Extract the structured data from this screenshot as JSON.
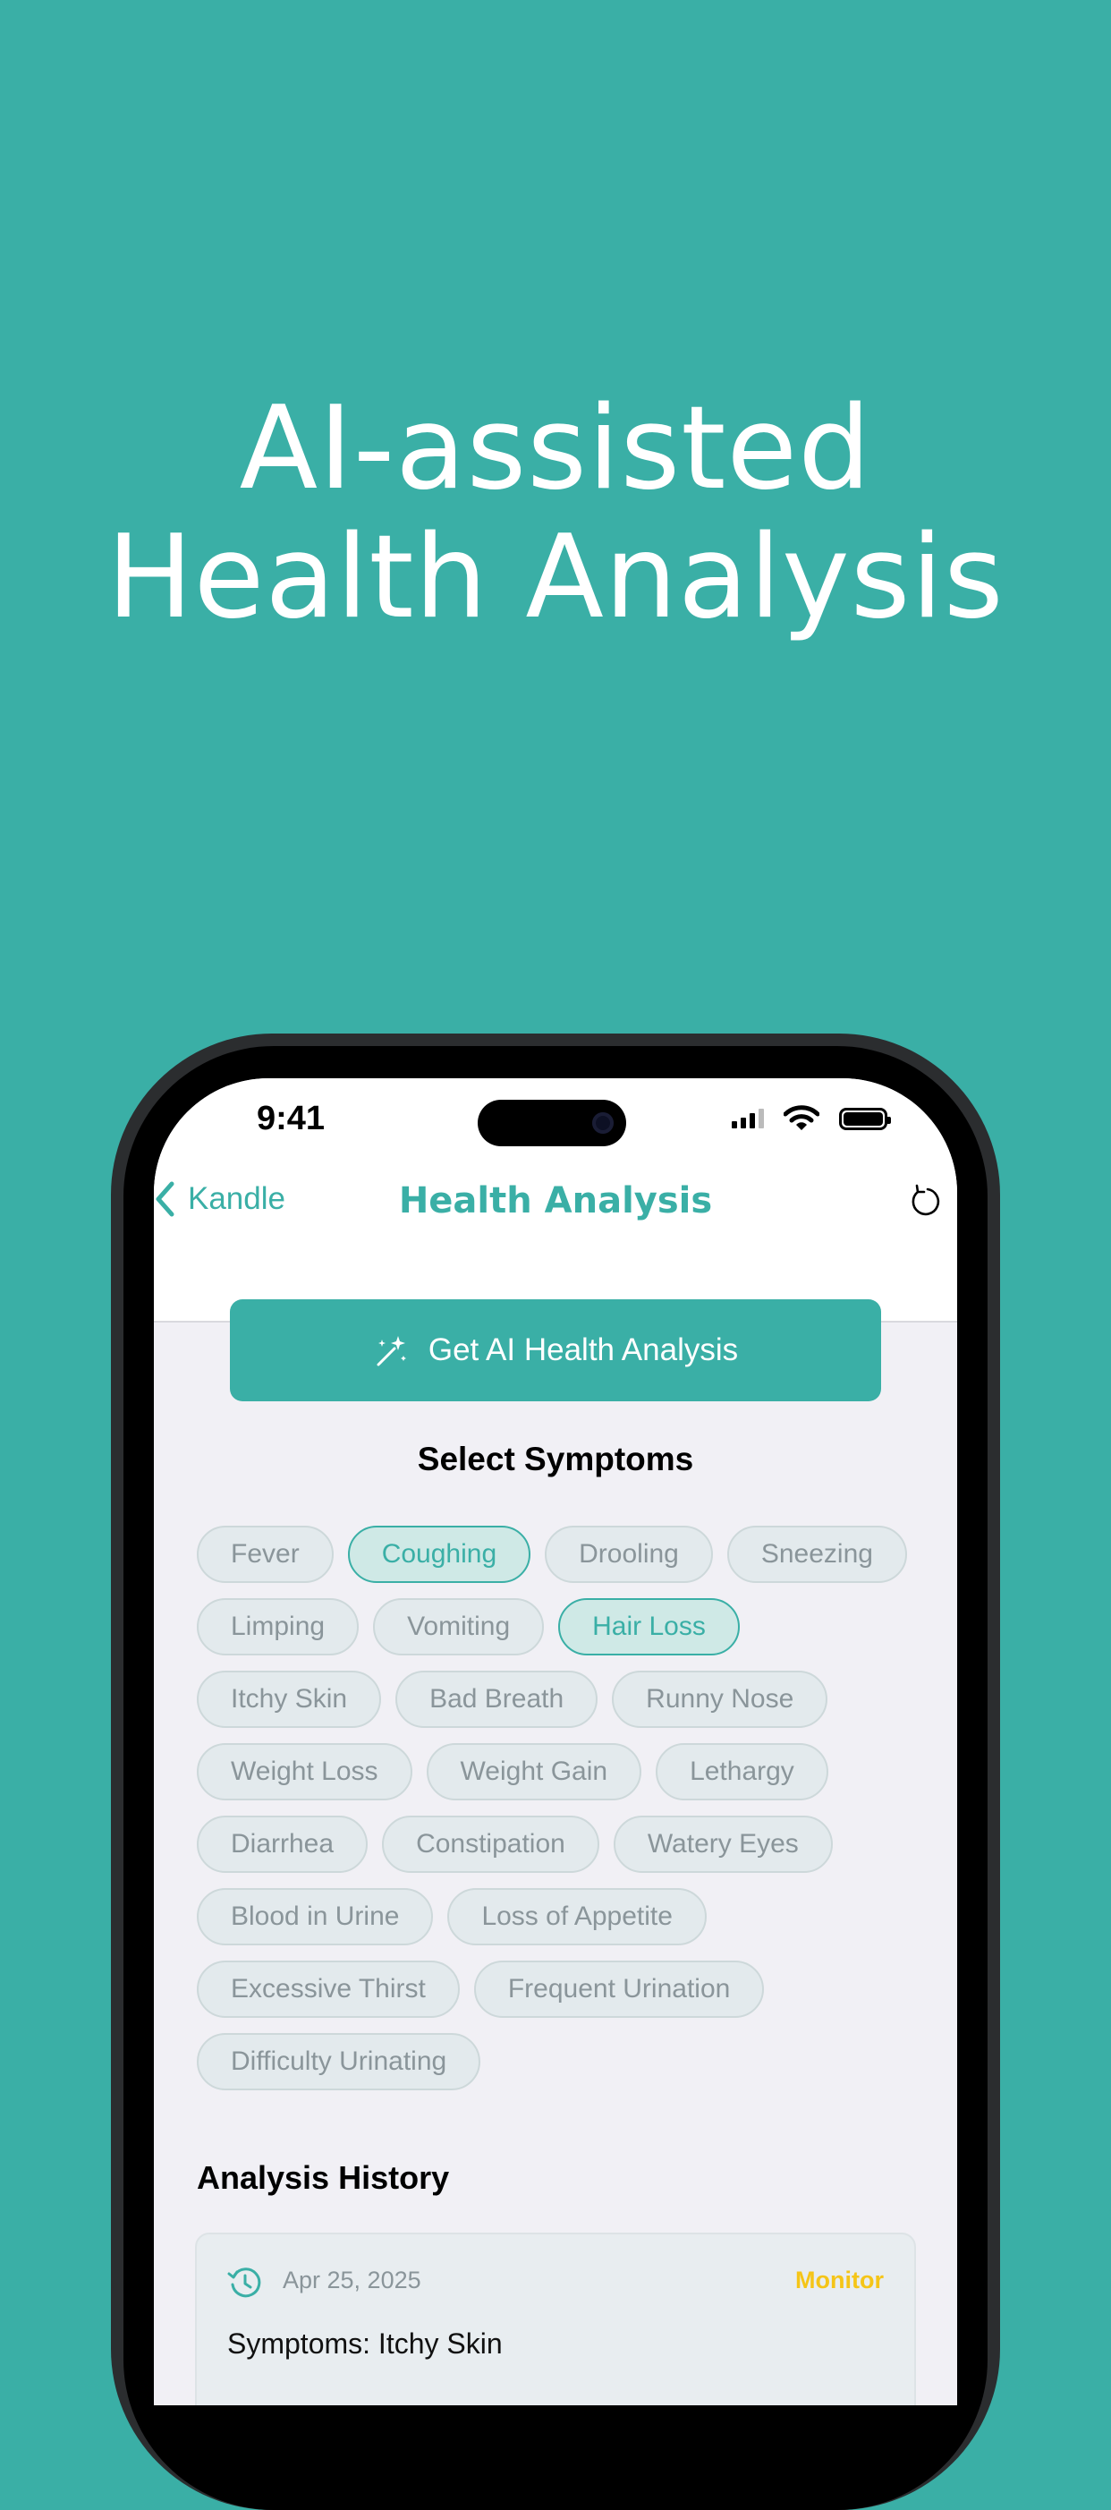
{
  "headline": {
    "line1": "AI-assisted",
    "line2": "Health Analysis"
  },
  "status_bar": {
    "time": "9:41"
  },
  "nav": {
    "back_label": "Kandle",
    "title": "Health Analysis"
  },
  "ai_button": {
    "label": "Get AI Health Analysis"
  },
  "symptoms": {
    "title": "Select Symptoms",
    "items": [
      {
        "label": "Fever",
        "selected": false
      },
      {
        "label": "Coughing",
        "selected": true
      },
      {
        "label": "Drooling",
        "selected": false
      },
      {
        "label": "Sneezing",
        "selected": false
      },
      {
        "label": "Limping",
        "selected": false
      },
      {
        "label": "Vomiting",
        "selected": false
      },
      {
        "label": "Hair Loss",
        "selected": true
      },
      {
        "label": "Itchy Skin",
        "selected": false
      },
      {
        "label": "Bad Breath",
        "selected": false
      },
      {
        "label": "Runny Nose",
        "selected": false
      },
      {
        "label": "Weight Loss",
        "selected": false
      },
      {
        "label": "Weight Gain",
        "selected": false
      },
      {
        "label": "Lethargy",
        "selected": false
      },
      {
        "label": "Diarrhea",
        "selected": false
      },
      {
        "label": "Constipation",
        "selected": false
      },
      {
        "label": "Watery Eyes",
        "selected": false
      },
      {
        "label": "Blood in Urine",
        "selected": false
      },
      {
        "label": "Loss of Appetite",
        "selected": false
      },
      {
        "label": "Excessive Thirst",
        "selected": false
      },
      {
        "label": "Frequent Urination",
        "selected": false
      },
      {
        "label": "Difficulty Urinating",
        "selected": false
      }
    ]
  },
  "history": {
    "title": "Analysis History",
    "entries": [
      {
        "date": "Apr 25, 2025",
        "status": "Monitor",
        "symptoms": "Symptoms: Itchy Skin"
      }
    ]
  },
  "colors": {
    "accent": "#3AAFA6",
    "monitor": "#F5C518",
    "background": "#3AAFA6"
  },
  "icons": [
    "chevron-left-icon",
    "refresh-icon",
    "magic-wand-icon",
    "history-icon",
    "signal-icon",
    "wifi-icon",
    "battery-icon"
  ]
}
